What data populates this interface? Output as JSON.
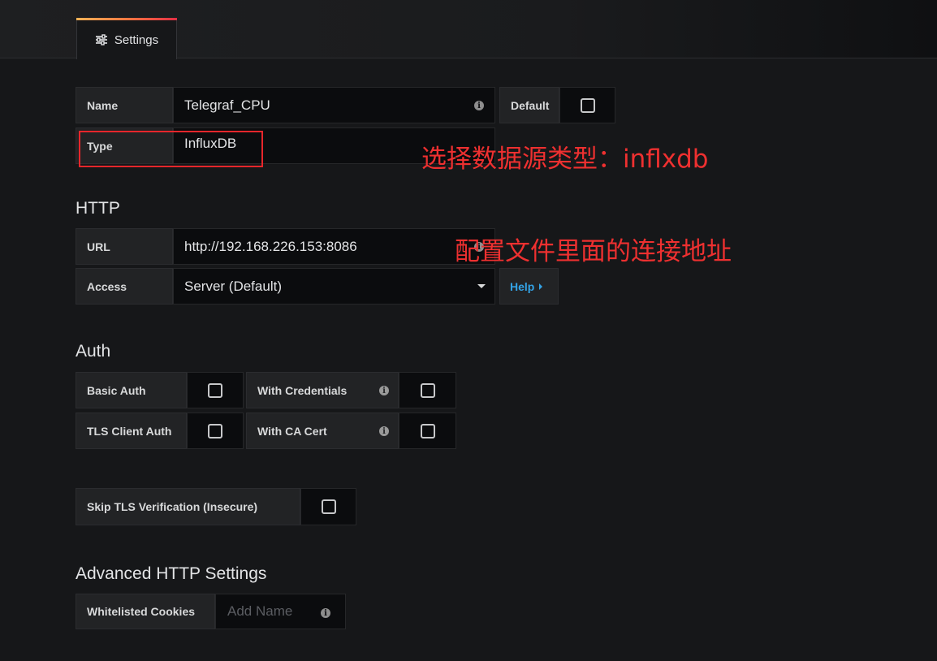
{
  "tab": {
    "label": "Settings",
    "icon": "sliders-icon"
  },
  "name": {
    "label": "Name",
    "value": "Telegraf_CPU",
    "default_label": "Default"
  },
  "type": {
    "label": "Type",
    "value": "InfluxDB"
  },
  "http": {
    "heading": "HTTP",
    "url_label": "URL",
    "url_value": "http://192.168.226.153:8086",
    "access_label": "Access",
    "access_value": "Server (Default)",
    "help_label": "Help"
  },
  "auth": {
    "heading": "Auth",
    "basic_auth": "Basic Auth",
    "with_credentials": "With Credentials",
    "tls_client_auth": "TLS Client Auth",
    "with_ca_cert": "With CA Cert",
    "skip_tls": "Skip TLS Verification (Insecure)"
  },
  "advanced": {
    "heading": "Advanced HTTP Settings",
    "whitelisted_cookies": "Whitelisted Cookies",
    "add_name_placeholder": "Add Name"
  },
  "annotations": {
    "type_note": "选择数据源类型：inflxdb",
    "url_note": "配置文件里面的连接地址"
  },
  "colors": {
    "annotation": "#e8262b",
    "help_link": "#33a2e5",
    "background": "#161719"
  }
}
